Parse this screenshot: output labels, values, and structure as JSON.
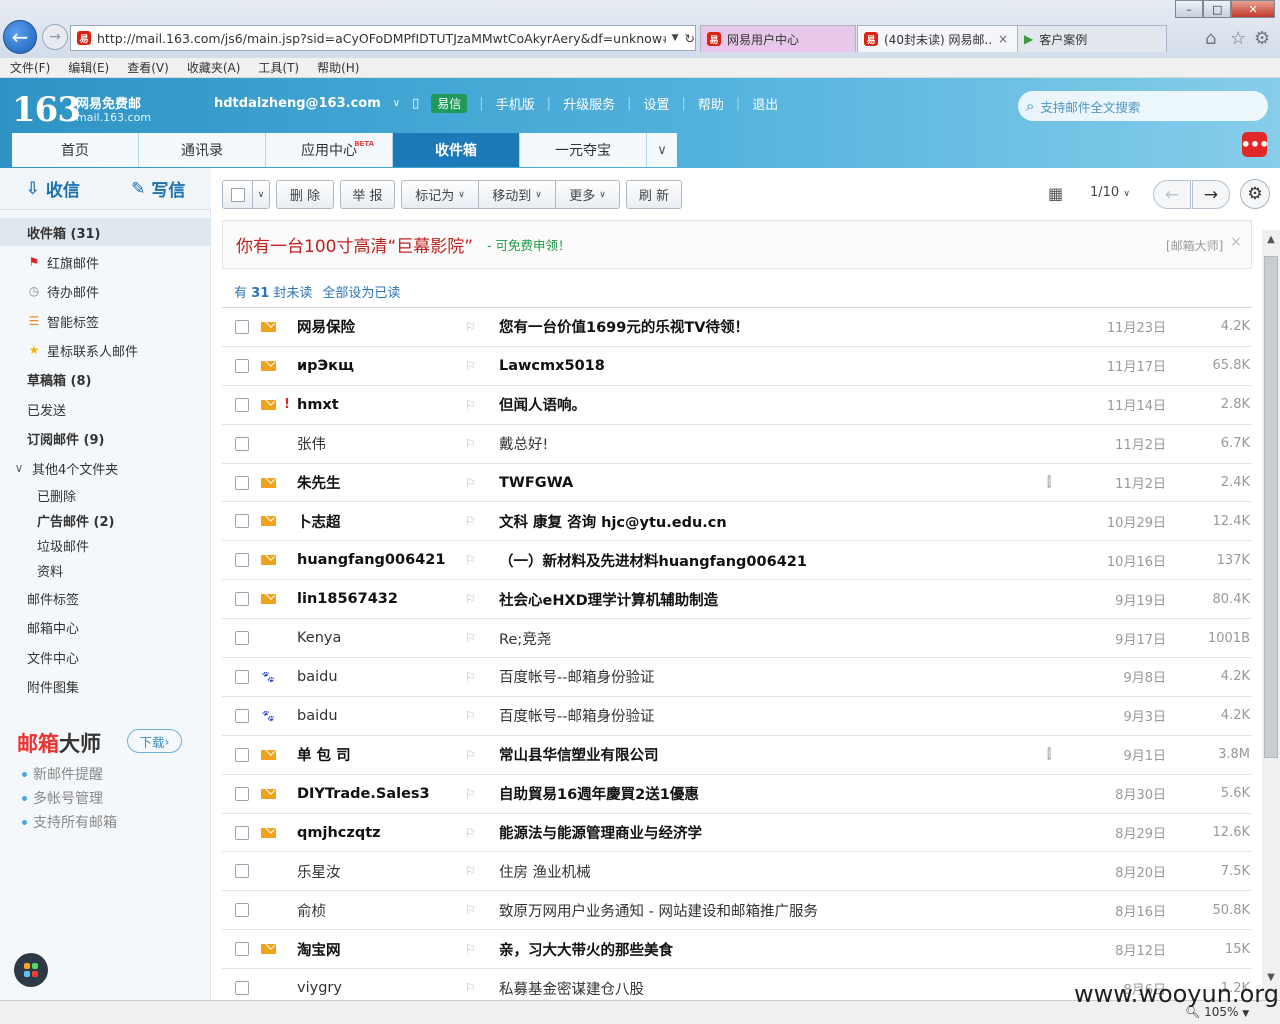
{
  "browser": {
    "url": "http://mail.163.com/js6/main.jsp?sid=aCyOFoDMPfIDTUTJzaMMwtCoAkyrAery&df=unknow#moc",
    "tabs": [
      "网易用户中心",
      "(40封未读) 网易邮...",
      "客户案例"
    ],
    "tab_close": "×",
    "menus": [
      "文件(F)",
      "编辑(E)",
      "查看(V)",
      "收藏夹(A)",
      "工具(T)",
      "帮助(H)"
    ],
    "zoom": "105%"
  },
  "header": {
    "logo_num": "163",
    "logo_name": "网易免费邮",
    "logo_domain": "mail.163.com",
    "account": "hdtdaizheng@163.com",
    "yixin": "易信",
    "links": [
      "手机版",
      "升级服务",
      "设置",
      "帮助",
      "退出"
    ],
    "search_placeholder": "支持邮件全文搜索",
    "more": "•••"
  },
  "nav_tabs": [
    {
      "label": "首页"
    },
    {
      "label": "通讯录"
    },
    {
      "label": "应用中心",
      "badge": "BETA"
    },
    {
      "label": "收件箱"
    },
    {
      "label": "一元夺宝"
    }
  ],
  "sidebar": {
    "receive": "收信",
    "write": "写信",
    "folders": [
      {
        "label": "收件箱 (31)",
        "icon": ""
      },
      {
        "label": "红旗邮件",
        "icon": "red-flag-icon"
      },
      {
        "label": "待办邮件",
        "icon": "clock-icon"
      },
      {
        "label": "智能标签",
        "icon": "tag-stack-icon"
      },
      {
        "label": "星标联系人邮件",
        "icon": "star-icon"
      },
      {
        "label": "草稿箱 (8)",
        "icon": ""
      },
      {
        "label": "已发送",
        "icon": ""
      },
      {
        "label": "订阅邮件 (9)",
        "icon": ""
      },
      {
        "label": "其他4个文件夹",
        "icon": "caret-icon"
      },
      {
        "label": "已删除",
        "icon": ""
      },
      {
        "label": "广告邮件 (2)",
        "icon": ""
      },
      {
        "label": "垃圾邮件",
        "icon": ""
      },
      {
        "label": "资料",
        "icon": ""
      },
      {
        "label": "邮件标签",
        "icon": ""
      },
      {
        "label": "邮箱中心",
        "icon": ""
      },
      {
        "label": "文件中心",
        "icon": ""
      },
      {
        "label": "附件图集",
        "icon": ""
      }
    ],
    "promo": {
      "brand_red": "邮箱",
      "brand_dark": "大师",
      "download": "下载",
      "features": [
        "新邮件提醒",
        "多帐号管理",
        "支持所有邮箱"
      ]
    }
  },
  "toolbar": {
    "delete": "删 除",
    "report": "举 报",
    "mark": "标记为",
    "move": "移动到",
    "more": "更多",
    "refresh": "刷 新",
    "page": "1/10"
  },
  "ad": {
    "title": "你有一台100寸高清“巨幕影院”",
    "sub": "- 可免费申领！",
    "source": "[邮箱大师]",
    "close": "×"
  },
  "unread": {
    "prefix": "有",
    "count": "31",
    "suffix": "封未读",
    "mark_all": "全部设为已读"
  },
  "emails": [
    {
      "from": "网易保险",
      "subject": "您有一台价值1699元的乐视TV待领！",
      "date": "11月23日",
      "size": "4.2K",
      "unread": true,
      "icon": "envelope",
      "urgent": false,
      "attach": false
    },
    {
      "from": "ирЭкщ",
      "subject": "Lawcmx5018",
      "date": "11月17日",
      "size": "65.8K",
      "unread": true,
      "icon": "envelope",
      "urgent": false,
      "attach": false
    },
    {
      "from": "hmxt",
      "subject": "但闻人语响。",
      "date": "11月14日",
      "size": "2.8K",
      "unread": true,
      "icon": "envelope",
      "urgent": true,
      "attach": false
    },
    {
      "from": "张伟",
      "subject": "戴总好!",
      "date": "11月2日",
      "size": "6.7K",
      "unread": false,
      "icon": "",
      "urgent": false,
      "attach": false
    },
    {
      "from": "朱先生",
      "subject": "TWFGWA",
      "date": "11月2日",
      "size": "2.4K",
      "unread": true,
      "icon": "envelope",
      "urgent": false,
      "attach": true
    },
    {
      "from": "卜志超",
      "subject": "文科 康复 咨询 hjc@ytu.edu.cn",
      "date": "10月29日",
      "size": "12.4K",
      "unread": true,
      "icon": "envelope",
      "urgent": false,
      "attach": false
    },
    {
      "from": "huangfang006421",
      "subject": "（一）新材料及先进材料huangfang006421",
      "date": "10月16日",
      "size": "137K",
      "unread": true,
      "icon": "envelope",
      "urgent": false,
      "attach": false
    },
    {
      "from": "lin18567432",
      "subject": "社会心eHXD理学计算机辅助制造",
      "date": "9月19日",
      "size": "80.4K",
      "unread": true,
      "icon": "envelope",
      "urgent": false,
      "attach": false
    },
    {
      "from": "Kenya",
      "subject": "Re;竞尧",
      "date": "9月17日",
      "size": "1001B",
      "unread": false,
      "icon": "",
      "urgent": false,
      "attach": false
    },
    {
      "from": "baidu",
      "subject": "百度帐号--邮箱身份验证",
      "date": "9月8日",
      "size": "4.2K",
      "unread": false,
      "icon": "paw",
      "urgent": false,
      "attach": false
    },
    {
      "from": "baidu",
      "subject": "百度帐号--邮箱身份验证",
      "date": "9月3日",
      "size": "4.2K",
      "unread": false,
      "icon": "paw",
      "urgent": false,
      "attach": false
    },
    {
      "from": "单 包 司",
      "subject": "常山县华信塑业有限公司",
      "date": "9月1日",
      "size": "3.8M",
      "unread": true,
      "icon": "envelope",
      "urgent": false,
      "attach": true
    },
    {
      "from": "DIYTrade.Sales3",
      "subject": "自助貿易16週年慶買2送1優惠",
      "date": "8月30日",
      "size": "5.6K",
      "unread": true,
      "icon": "envelope",
      "urgent": false,
      "attach": false
    },
    {
      "from": "qmjhczqtz",
      "subject": "能源法与能源管理商业与经济学",
      "date": "8月29日",
      "size": "12.6K",
      "unread": true,
      "icon": "envelope",
      "urgent": false,
      "attach": false
    },
    {
      "from": "乐星汝",
      "subject": "住房 渔业机械",
      "date": "8月20日",
      "size": "7.5K",
      "unread": false,
      "icon": "",
      "urgent": false,
      "attach": false
    },
    {
      "from": "俞桢",
      "subject": "致原万网用户业务通知 - 网站建设和邮箱推广服务",
      "date": "8月16日",
      "size": "50.8K",
      "unread": false,
      "icon": "",
      "urgent": false,
      "attach": false
    },
    {
      "from": "淘宝网",
      "subject": "亲，习大大带火的那些美食",
      "date": "8月12日",
      "size": "15K",
      "unread": true,
      "icon": "envelope",
      "urgent": false,
      "attach": false
    },
    {
      "from": "viygry",
      "subject": "私募基金密谋建仓八股",
      "date": "8月6日",
      "size": "1.2K",
      "unread": false,
      "icon": "",
      "urgent": false,
      "attach": false
    }
  ],
  "watermark": "www.wooyun.org",
  "colors": {
    "accent": "#1b7ab7",
    "unread_envelope": "#f0a21c",
    "ad_title": "#c0211f"
  }
}
